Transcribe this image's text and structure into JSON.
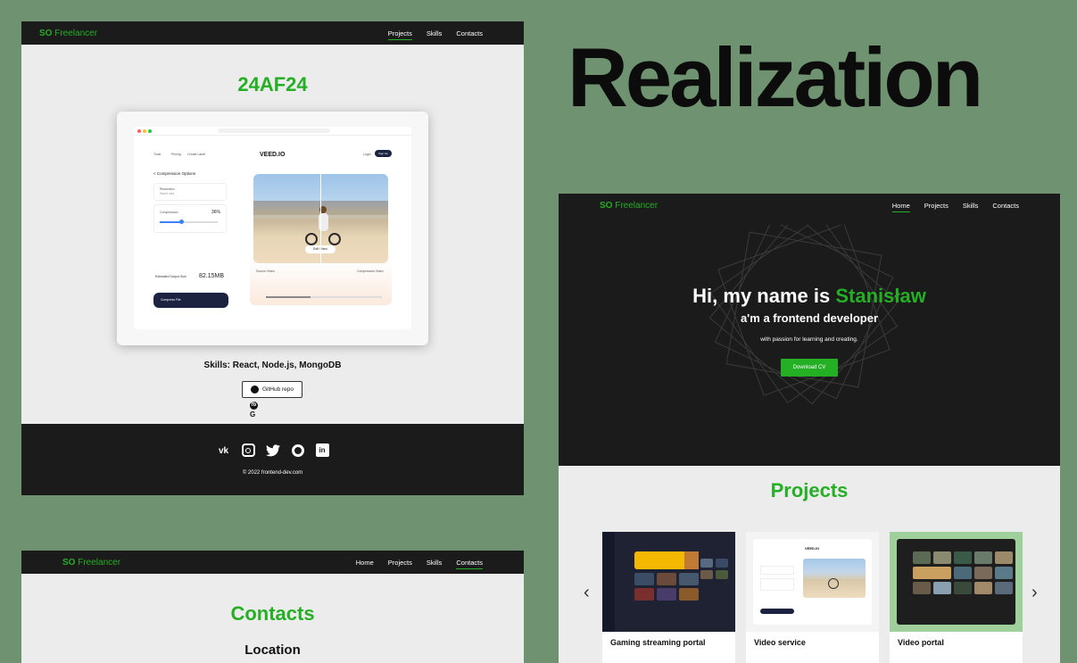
{
  "brand": {
    "bold": "SO",
    "light": " Freelancer",
    "accent": "#24AF24"
  },
  "project_page": {
    "nav": [
      "Projects",
      "Skills",
      "Contacts"
    ],
    "active": 0,
    "title": "24AF24",
    "mockup": {
      "logo": "VEED.IO",
      "menu": [
        "Tools",
        "Pricing",
        "Create Label"
      ],
      "login": "Login",
      "signup": "Sign Up",
      "back": "< Compression Options",
      "resolution_label": "Resolution",
      "resolution_value": "Same size",
      "compression_label": "Compression",
      "compression_value": "36%",
      "estimated_label": "Estimated Output Size",
      "estimated_value": "82.15MB",
      "compress_btn": "Compress File",
      "edit_video": "Edit Video",
      "source_video": "Source Video",
      "compressed_video": "Compressed Video"
    },
    "skills": "Skills: React, Node.js, MongoDB",
    "github": "GitHub repo",
    "mini_icons": [
      "fb",
      "G"
    ],
    "socials": [
      "vk",
      "instagram",
      "twitter",
      "github",
      "linkedin"
    ],
    "copyright": "© 2022 frontend-dev.com"
  },
  "contacts_page": {
    "nav": [
      "Home",
      "Projects",
      "Skills",
      "Contacts"
    ],
    "active": 3,
    "title": "Contacts",
    "location": "Location"
  },
  "headline": "Realization",
  "home_page": {
    "nav": [
      "Home",
      "Projects",
      "Skills",
      "Contacts"
    ],
    "active": 0,
    "greeting": "Hi, my name is ",
    "name": "Stanisław",
    "subtitle": "a'm a frontend developer",
    "tagline": "with passion for learning and creating.",
    "cv_button": "Download CV",
    "projects_title": "Projects",
    "prev_arrow": "‹",
    "next_arrow": "›",
    "cards": [
      {
        "label": "Gaming streaming portal"
      },
      {
        "label": "Video service"
      },
      {
        "label": "Video portal"
      }
    ]
  }
}
